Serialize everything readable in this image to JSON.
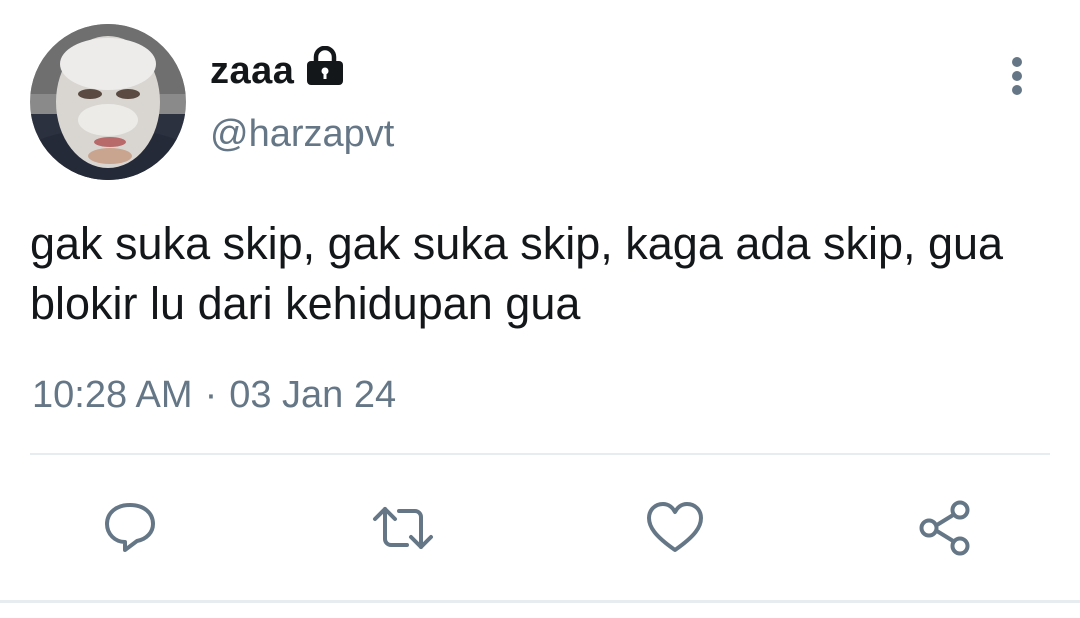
{
  "tweet": {
    "author": {
      "display_name": "zaaa",
      "handle": "@harzapvt",
      "protected": true
    },
    "text": "gak suka skip, gak suka skip, kaga ada skip, gua blokir lu dari kehidupan gua",
    "time": "10:28 AM",
    "separator": "·",
    "date": "03 Jan 24"
  },
  "header": {
    "icons": {
      "lock": "lock-icon",
      "more": "more-vertical-icon"
    }
  },
  "actions": [
    {
      "name": "reply",
      "icon": "reply-icon"
    },
    {
      "name": "retweet",
      "icon": "retweet-icon"
    },
    {
      "name": "like",
      "icon": "heart-icon"
    },
    {
      "name": "share",
      "icon": "share-icon"
    }
  ],
  "colors": {
    "text_primary": "#14171a",
    "text_secondary": "#657786",
    "icon": "#657786",
    "divider": "#e6ecf0"
  }
}
